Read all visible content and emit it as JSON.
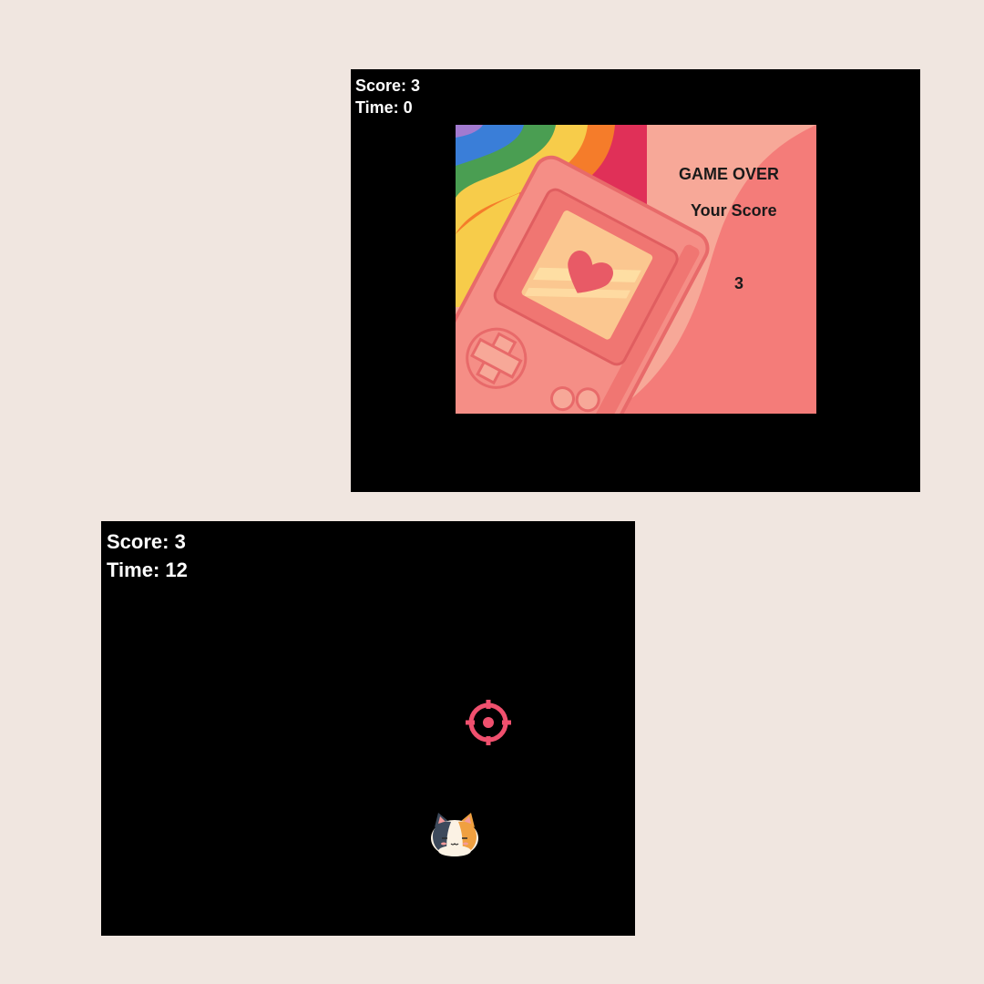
{
  "screens": {
    "game_over": {
      "hud": {
        "score": "Score: 3",
        "time": "Time: 0"
      },
      "panel": {
        "title": "GAME OVER",
        "label": "Your Score",
        "value": "3"
      }
    },
    "playing": {
      "hud": {
        "score": "Score: 3",
        "time": "Time: 12"
      },
      "sprites": [
        "crosshair-icon",
        "calico-cat-icon"
      ]
    }
  },
  "colors": {
    "page_background": "#f0e6e0",
    "game_background": "#000000",
    "hud_text": "#ffffff",
    "crosshair": "#f0506e",
    "panel_pink": "#f47c79",
    "panel_light": "#f7a898"
  }
}
